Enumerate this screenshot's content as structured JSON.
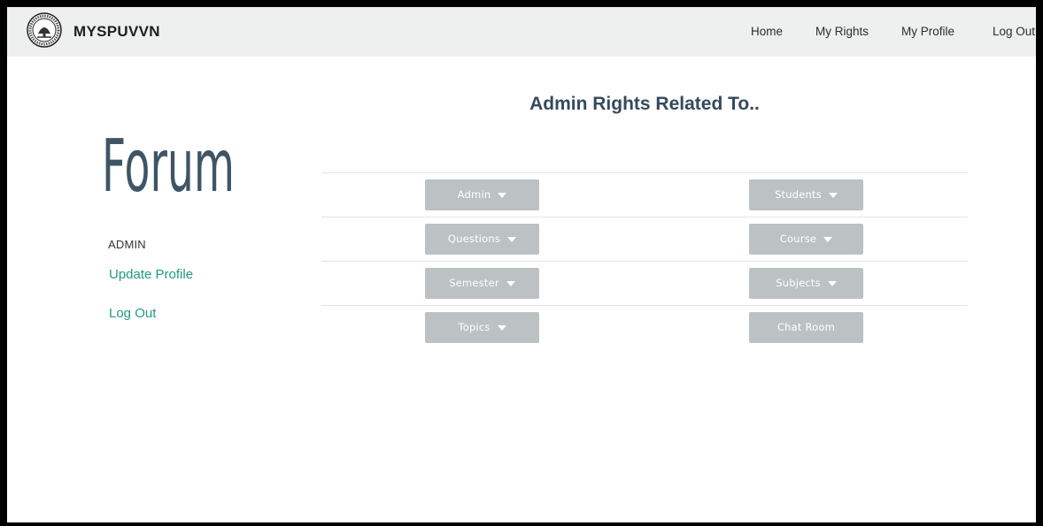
{
  "brand": {
    "name": "MYSPUVVN"
  },
  "nav": {
    "home": "Home",
    "my_rights": "My Rights",
    "my_profile": "My Profile",
    "log_out": "Log Out"
  },
  "sidebar": {
    "logo_text": "Forum",
    "role": "ADMIN",
    "update_profile": "Update Profile",
    "log_out": "Log Out"
  },
  "main": {
    "heading": "Admin Rights Related To..",
    "buttons": [
      {
        "label": "Admin",
        "dropdown": true
      },
      {
        "label": "Students",
        "dropdown": true
      },
      {
        "label": "Questions",
        "dropdown": true
      },
      {
        "label": "Course",
        "dropdown": true
      },
      {
        "label": "Semester",
        "dropdown": true
      },
      {
        "label": "Subjects",
        "dropdown": true
      },
      {
        "label": "Topics",
        "dropdown": true
      },
      {
        "label": "Chat Room",
        "dropdown": false
      }
    ]
  },
  "colors": {
    "accent_link": "#1f9b86",
    "button_bg": "#bcc1c4",
    "heading": "#34495e",
    "navbar_bg": "#eef0f0"
  },
  "icons": [
    "university-seal-icon",
    "forum-logo-icon",
    "caret-down-icon"
  ]
}
